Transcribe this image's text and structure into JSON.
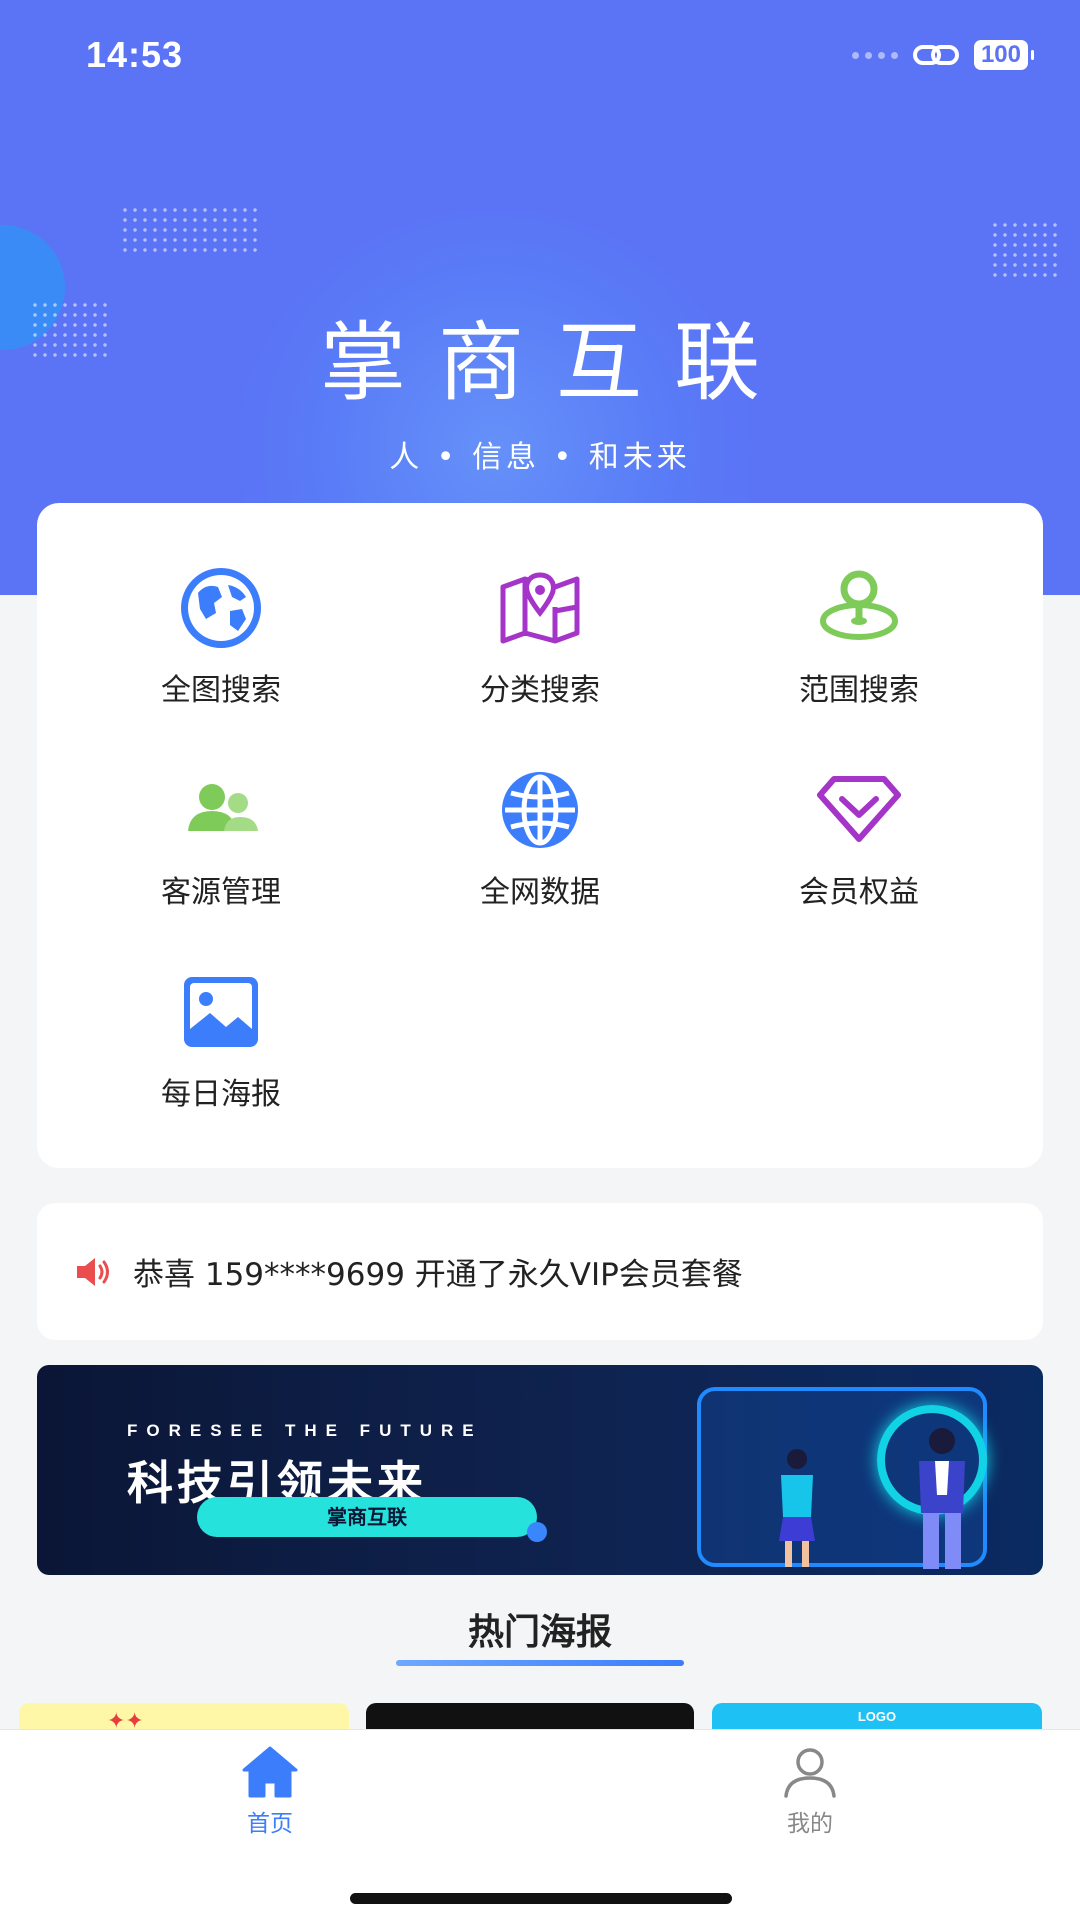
{
  "status_bar": {
    "time": "14:53",
    "battery": "100"
  },
  "hero": {
    "title": "掌商互联",
    "subtitle": "人 • 信息 • 和未来"
  },
  "features": [
    {
      "label": "全图搜索",
      "icon": "globe-earth-icon"
    },
    {
      "label": "分类搜索",
      "icon": "map-pin-icon"
    },
    {
      "label": "范围搜索",
      "icon": "location-radius-icon"
    },
    {
      "label": "客源管理",
      "icon": "users-icon"
    },
    {
      "label": "全网数据",
      "icon": "globe-grid-icon"
    },
    {
      "label": "会员权益",
      "icon": "diamond-icon"
    },
    {
      "label": "每日海报",
      "icon": "image-icon"
    }
  ],
  "notice": {
    "text": "恭喜 159****9699 开通了永久VIP会员套餐",
    "icon": "speaker-icon"
  },
  "banner": {
    "english": "FORESEE THE FUTURE",
    "chinese": "科技引领未来",
    "pill": "掌商互联"
  },
  "hot_posters": {
    "title": "热门海报",
    "poster_3_logo": "LOGO"
  },
  "tabbar": {
    "home": "首页",
    "mine": "我的"
  },
  "colors": {
    "primary": "#5b73f5",
    "accent_blue": "#3b7dfb",
    "purple": "#a535c8",
    "green": "#7fcb5a",
    "red": "#e94d4d"
  }
}
